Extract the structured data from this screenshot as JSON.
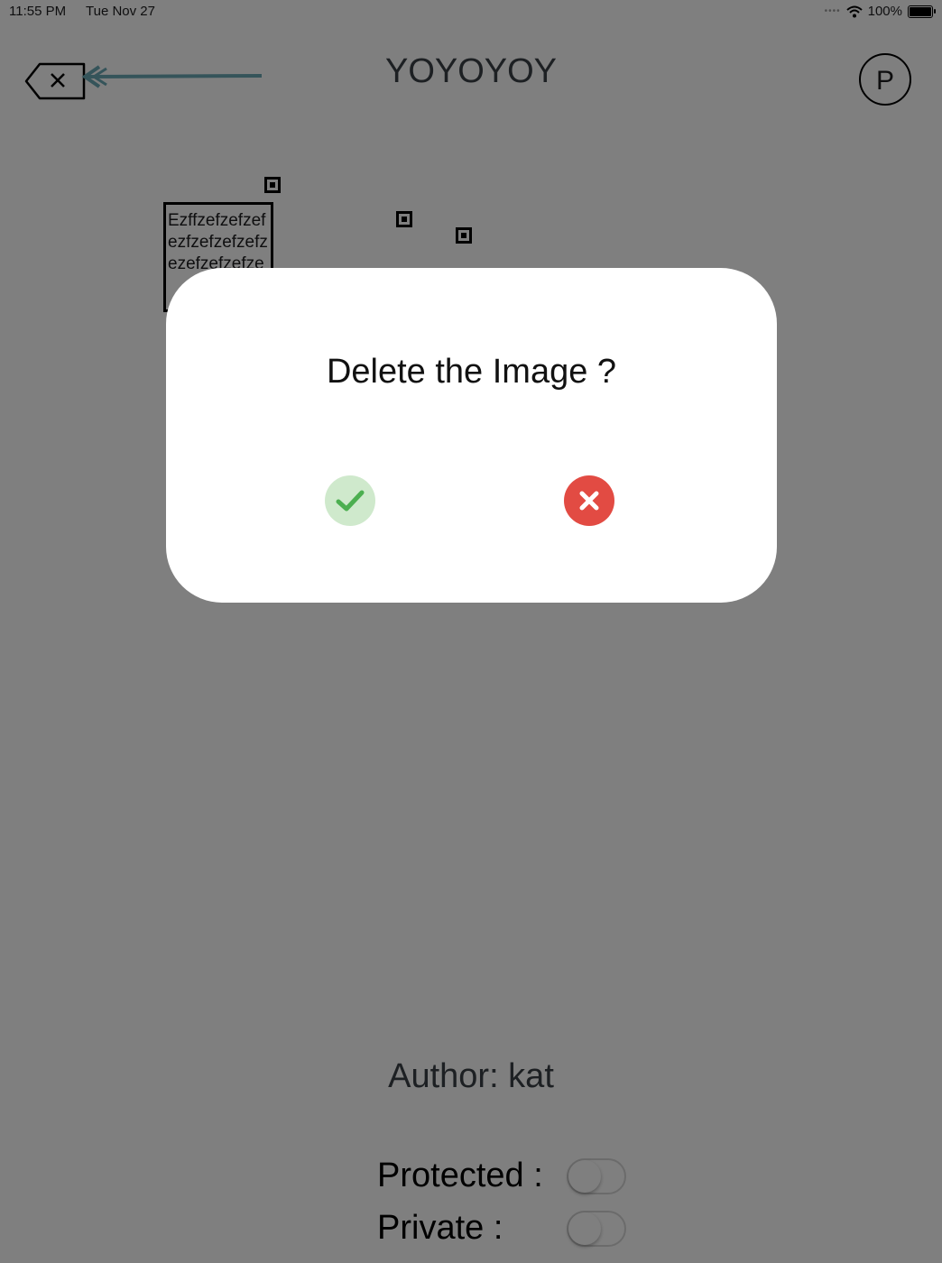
{
  "status_bar": {
    "time": "11:55 PM",
    "date": "Tue Nov 27",
    "battery": "100%"
  },
  "header": {
    "title": "YOYOYOY",
    "profile_initial": "P"
  },
  "canvas": {
    "note_text": "Ezffzefzefzefezfzefzefzefzezefzefzefze"
  },
  "footer": {
    "author": "Author: kat",
    "protected_label": "Protected :",
    "private_label": "Private :"
  },
  "dialog": {
    "title": "Delete the Image ?"
  },
  "colors": {
    "confirm_bg": "#cfe9cc",
    "confirm_icon": "#4caf50",
    "cancel_bg": "#e24b43",
    "overlay": "rgba(0,0,0,0.5)"
  }
}
